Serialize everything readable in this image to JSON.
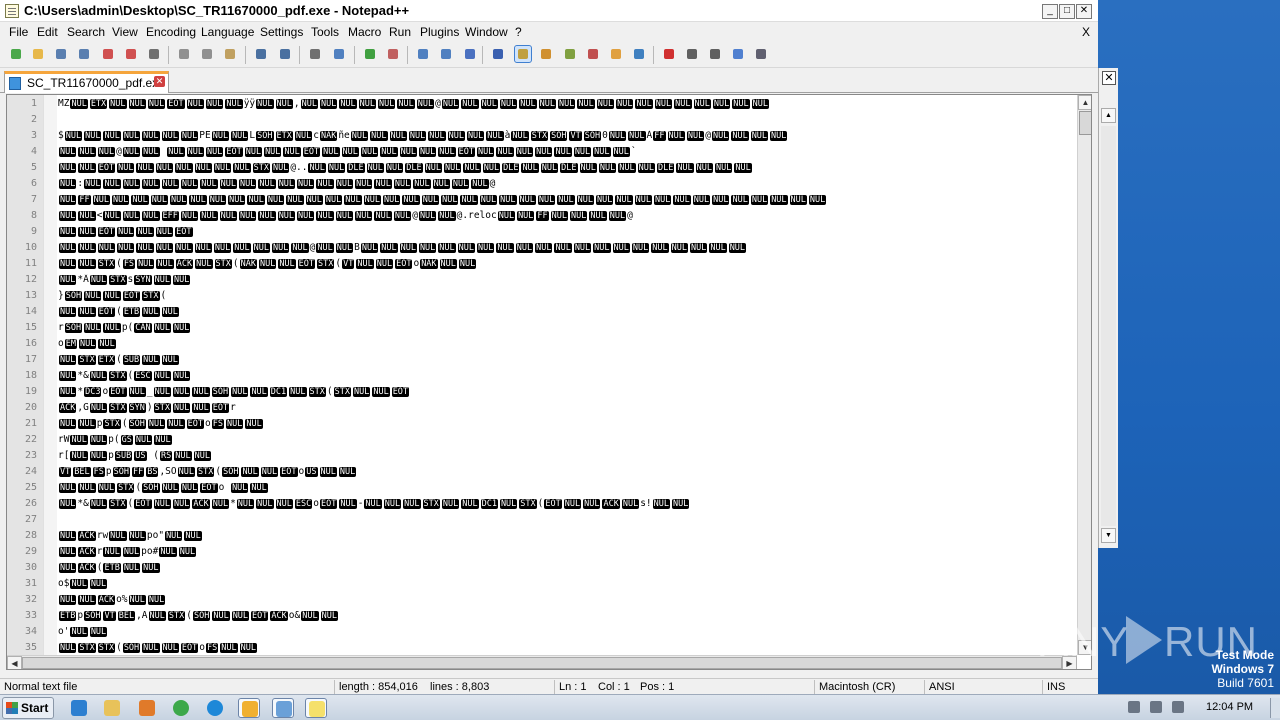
{
  "window": {
    "title": "C:\\Users\\admin\\Desktop\\SC_TR11670000_pdf.exe - Notepad++",
    "minimize_label": "_",
    "restore_label": "□",
    "close_label": "✕"
  },
  "menu": {
    "items": [
      "File",
      "Edit",
      "Search",
      "View",
      "Encoding",
      "Language",
      "Settings",
      "Tools",
      "Macro",
      "Run",
      "Plugins",
      "Window",
      "?"
    ],
    "close_label": "X"
  },
  "toolbar": {
    "icons": [
      "new-file-icon",
      "open-file-icon",
      "save-icon",
      "save-all-icon",
      "close-icon",
      "close-all-icon",
      "print-icon",
      "cut-icon",
      "copy-icon",
      "paste-icon",
      "undo-icon",
      "redo-icon",
      "find-icon",
      "replace-icon",
      "zoom-in-icon",
      "zoom-out-icon",
      "sync-vertical-icon",
      "sync-horizontal-icon",
      "word-wrap-icon",
      "show-all-chars-icon",
      "indent-guide-icon",
      "user-language-icon",
      "document-map-icon",
      "function-list-icon",
      "folder-workspace-icon",
      "monitoring-icon",
      "record-macro-icon",
      "stop-record-icon",
      "play-macro-icon",
      "run-macro-multiple-icon",
      "save-macro-icon"
    ]
  },
  "tab": {
    "label": "SC_TR11670000_pdf.exe",
    "close_label": "✕"
  },
  "editor": {
    "lines": [
      {
        "n": "1",
        "t": "MZ|NUL|ETX|NUL|NUL|NUL|EOT|NUL|NUL|NUL|ÿÿ|NUL|NUL|,|NUL|NUL|NUL|NUL|NUL|NUL|NUL|@|NUL|NUL|NUL|NUL|NUL|NUL|NUL|NUL|NUL|NUL|NUL|NUL|NUL|NUL|NUL|NUL|NUL"
      },
      {
        "n": "2",
        "t": ""
      },
      {
        "n": "3",
        "t": "$|NUL|NUL|NUL|NUL|NUL|NUL|NUL|PE|NUL|NUL|L|SOH|ETX|NUL|c|NAK|ñe|NUL|NUL|NUL|NUL|NUL|NUL|NUL|NUL|à|NUL|STX|SOH|VT|SOH|0|NUL|NUL|À|FF|NUL|NUL|@|NUL|NUL|NUL|NUL"
      },
      {
        "n": "4",
        "t": "NUL|NUL|NUL|@|NUL|NUL|  |NUL|NUL|NUL|EOT|NUL|NUL|NUL|EOT|NUL|NUL|NUL|NUL|NUL|NUL|NUL|EOT|NUL|NUL|NUL|NUL|NUL|NUL|NUL|NUL|`"
      },
      {
        "n": "5",
        "t": "NUL|NUL|EOT|NUL|NUL|NUL|NUL|NUL|NUL|NUL|STX|NUL|@..|NUL|NUL|DLE|NUL|NUL|DLE|NUL|NUL|NUL|NUL|DLE|NUL|NUL|DLE|NUL|NUL|NUL|NUL|DLE|NUL|NUL|NUL|NUL"
      },
      {
        "n": "6",
        "t": "NUL|:|NUL|NUL|NUL|NUL|NUL|NUL|NUL|NUL|NUL|NUL|NUL|NUL|NUL|NUL|NUL|NUL|NUL|NUL|NUL|NUL|NUL|@"
      },
      {
        "n": "7",
        "t": "NUL|FF|NUL|NUL|NUL|NUL|NUL|NUL|NUL|NUL|NUL|NUL|NUL|NUL|NUL|NUL|NUL|NUL|NUL|NUL|NUL|NUL|NUL|NUL|NUL|NUL|NUL|NUL|NUL|NUL|NUL|NUL|NUL|NUL|NUL|NUL|NUL|NUL|NUL|NUL"
      },
      {
        "n": "8",
        "t": "NUL|NUL|<|NUL|NUL|NUL|EFF|NUL|NUL|NUL|NUL|NUL|NUL|NUL|NUL|NUL|NUL|NUL|NUL|@|NUL|NUL|@.reloc|NUL|NUL|FF|NUL|NUL|NUL|NUL|@"
      },
      {
        "n": "9",
        "t": "NUL|NUL|EOT|NUL|NUL|NUL|EOT"
      },
      {
        "n": "10",
        "t": "NUL|NUL|NUL|NUL|NUL|NUL|NUL|NUL|NUL|NUL|NUL|NUL|NUL|@|NUL|NUL|B|NUL|NUL|NUL|NUL|NUL|NUL|NUL|NUL|NUL|NUL|NUL|NUL|NUL|NUL|NUL|NUL|NUL|NUL|NUL|NUL"
      },
      {
        "n": "11",
        "t": "NUL|NUL|STX|(|FS|NUL|NUL|ACK|NUL|STX|(|NAK|NUL|NUL|EOT|STX|(|VT|NUL|NUL|EOT|o|NAK|NUL|NUL"
      },
      {
        "n": "12",
        "t": "NUL|*Â|NUL|STX|s|SYN|NUL|NUL"
      },
      {
        "n": "13",
        "t": "}|SOH|NUL|NUL|EOT|STX|("
      },
      {
        "n": "14",
        "t": "NUL|NUL|EOT|(|ETB|NUL|NUL"
      },
      {
        "n": "15",
        "t": "r|SOH|NUL|NUL|p(|CAN|NUL|NUL"
      },
      {
        "n": "16",
        "t": "o|EM|NUL|NUL"
      },
      {
        "n": "17",
        "t": "NUL|STX|ETX|(|SUB|NUL|NUL"
      },
      {
        "n": "18",
        "t": "NUL|*&|NUL|STX|(|ESC|NUL|NUL"
      },
      {
        "n": "19",
        "t": "NUL|*|DC3|o|EOT|NUL|_|NUL|NUL|NUL|SOH|NUL|NUL|DC1|NUL|STX|(|STX|NUL|NUL|EOT"
      },
      {
        "n": "20",
        "t": "ACK|,G|NUL|STX|SYN|)|STX|NUL|NUL|EOT|r"
      },
      {
        "n": "21",
        "t": "NUL|NUL|p|STX|(|SOH|NUL|NUL|EOT|o|FS|NUL|NUL"
      },
      {
        "n": "22",
        "t": "rW|NUL|NUL|p(|GS|NUL|NUL"
      },
      {
        "n": "23",
        "t": "r[|NUL|NUL|p|SUB|US| (|RS|NUL|NUL"
      },
      {
        "n": "24",
        "t": "VT|BEL|FS|p|SOH|FF|BS|,SO|NUL|STX|(|SOH|NUL|NUL|EOT|o|US|NUL|NUL"
      },
      {
        "n": "25",
        "t": "NUL|NUL|NUL|STX|(|SOH|NUL|NUL|EOT|o |NUL|NUL"
      },
      {
        "n": "26",
        "t": "NUL|*&|NUL|STX|(|EOT|NUL|NUL|ACK|NUL|*|NUL|NUL|NUL|ESC|o|EOT|NUL|-|NUL|NUL|NUL|STX|NUL|NUL|DC1|NUL|STX|(|EOT|NUL|NUL|ACK|NUL|s!|NUL|NUL"
      },
      {
        "n": "27",
        "t": ""
      },
      {
        "n": "28",
        "t": "NUL|ACK|rw|NUL|NUL|po\"|NUL|NUL"
      },
      {
        "n": "29",
        "t": "NUL|ACK|r|NUL|NUL|po#|NUL|NUL"
      },
      {
        "n": "30",
        "t": "NUL|ACK|(|ETB|NUL|NUL"
      },
      {
        "n": "31",
        "t": "o$|NUL|NUL"
      },
      {
        "n": "32",
        "t": "NUL|NUL|ACK|o%|NUL|NUL"
      },
      {
        "n": "33",
        "t": "ETB|p|SOH|VT|BEL|,A|NUL|STX|(|SOH|NUL|NUL|EOT|ACK|o&|NUL|NUL"
      },
      {
        "n": "34",
        "t": "o'|NUL|NUL"
      },
      {
        "n": "35",
        "t": "NUL|STX|STX|(|SOH|NUL|NUL|EOT|o|FS|NUL|NUL"
      }
    ]
  },
  "statusbar": {
    "type": "Normal text file",
    "length": "length : 854,016",
    "lines": "lines : 8,803",
    "ln": "Ln : 1",
    "col": "Col : 1",
    "pos": "Pos : 1",
    "eol": "Macintosh (CR)",
    "encoding": "ANSI",
    "mode": "INS"
  },
  "desktop": {
    "watermark_left": "ANY",
    "watermark_right": "RUN",
    "testmode_line1": "Test Mode",
    "testmode_line2": "Windows 7",
    "testmode_line3": "Build 7601"
  },
  "taskbar": {
    "start_label": "Start",
    "items": [
      "internet-explorer-icon",
      "file-explorer-icon",
      "media-player-icon",
      "chrome-icon",
      "edge-icon",
      "outlook-icon",
      "notepad-icon",
      "notepadpp-icon"
    ],
    "clock": "12:04 PM"
  },
  "colors": {
    "tab_accent": "#f5a53c",
    "control_char_bg": "#000000",
    "desktop_bg": "#1d63b8"
  }
}
